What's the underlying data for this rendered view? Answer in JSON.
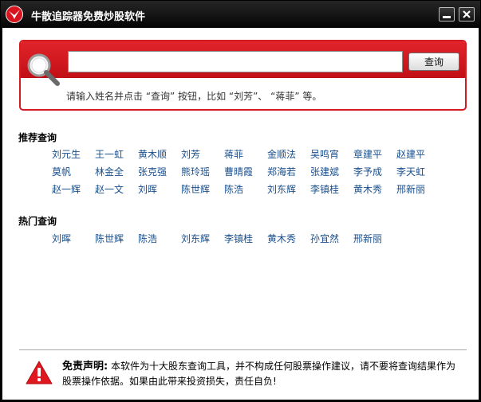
{
  "window": {
    "title": "牛散追踪器免费炒股软件",
    "logo_icon": "red-bird-logo-icon",
    "minimize_icon": "minimize-icon",
    "close_icon": "close-icon"
  },
  "colors": {
    "accent_red": "#d31b22",
    "link_blue": "#1a4f8c",
    "titlebar": "#0a0a0a"
  },
  "search": {
    "value": "",
    "placeholder": "",
    "button_label": "查询",
    "hint": "请输入姓名并点击 “查询” 按钮，比如 “刘芳”、 “蒋菲” 等。",
    "icon": "magnifier-icon"
  },
  "recommend": {
    "title": "推荐查询",
    "names": [
      "刘元生",
      "王一虹",
      "黄木顺",
      "刘芳",
      "蒋菲",
      "金顺法",
      "吴鸣宵",
      "章建平",
      "赵建平",
      "莫帆",
      "林金全",
      "张克强",
      "熊玲瑶",
      "曹晴霞",
      "郑海若",
      "张建斌",
      "李予成",
      "李天虹",
      "赵一辉",
      "赵一文",
      "刘晖",
      "陈世辉",
      "陈浩",
      "刘东辉",
      "李镇桂",
      "黄木秀",
      "邢新丽"
    ]
  },
  "hot": {
    "title": "热门查询",
    "names": [
      "刘晖",
      "陈世辉",
      "陈浩",
      "刘东辉",
      "李镇桂",
      "黄木秀",
      "孙宜然",
      "邢新丽"
    ]
  },
  "disclaimer": {
    "label": "免责声明:",
    "text": "本软件为十大股东查询工具，并不构成任何股票操作建议，请不要将查询结果作为股票操作依据。如果由此带来投资损失，责任自负!",
    "icon": "warning-icon"
  }
}
